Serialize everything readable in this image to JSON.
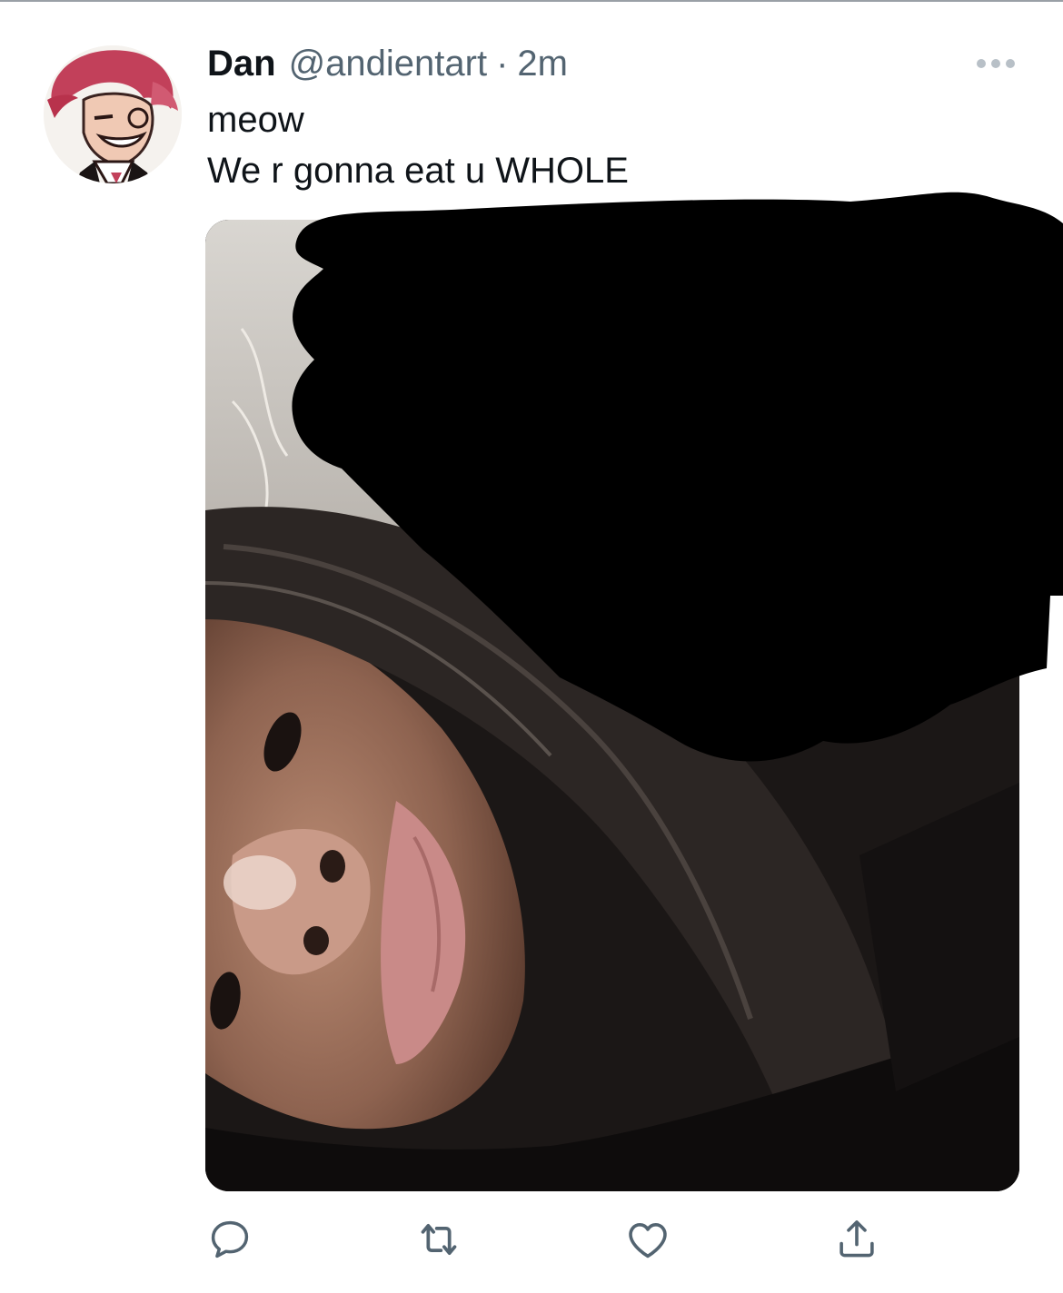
{
  "tweet": {
    "display_name": "Dan",
    "handle": "@andientart",
    "separator": "·",
    "time": "2m",
    "text_lines": [
      "meow",
      "We r gonna eat u WHOLE"
    ]
  },
  "icons": {
    "more": "more-horizontal-icon",
    "reply": "reply-icon",
    "retweet": "retweet-icon",
    "like": "like-icon",
    "share": "share-icon"
  },
  "colors": {
    "text_primary": "#0f1419",
    "text_secondary": "#536471",
    "icon": "#536471",
    "avatar_hair": "#c2405a"
  }
}
